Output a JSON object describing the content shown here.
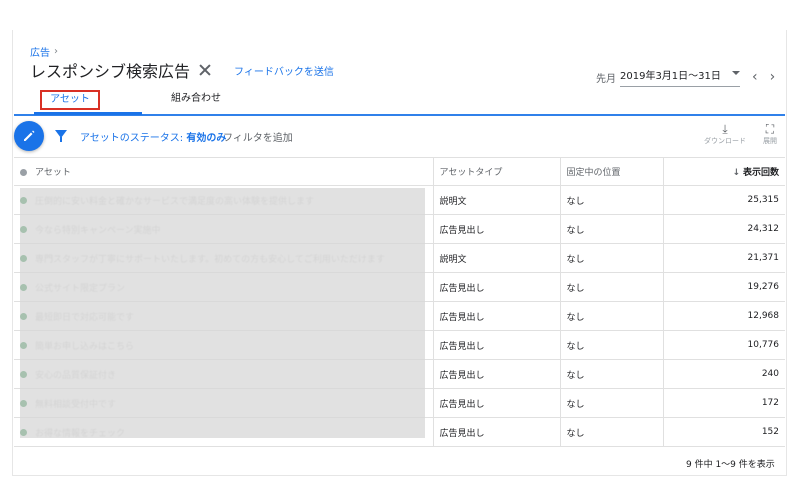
{
  "breadcrumb": {
    "parent": "広告"
  },
  "header": {
    "title": "レスポンシブ検索広告",
    "feedback": "フィードバックを送信"
  },
  "date_range": {
    "label": "先月",
    "value": "2019年3月1日～31日"
  },
  "tabs": [
    {
      "label": "アセット",
      "active": true
    },
    {
      "label": "組み合わせ",
      "active": false
    }
  ],
  "toolbar": {
    "filter_prefix": "アセットのステータス: ",
    "filter_value": "有効のみ",
    "add_filter": "フィルタを追加",
    "download_label": "ダウンロード",
    "expand_label": "展開"
  },
  "table": {
    "columns": [
      "アセット",
      "アセットタイプ",
      "固定中の位置",
      "表示回数"
    ],
    "rows": [
      {
        "asset": "圧倒的に安い料金と確かなサービスで満足度の高い体験を提供します",
        "type": "説明文",
        "position": "なし",
        "impressions": "25,315"
      },
      {
        "asset": "今なら特別キャンペーン実施中",
        "type": "広告見出し",
        "position": "なし",
        "impressions": "24,312"
      },
      {
        "asset": "専門スタッフが丁寧にサポートいたします。初めての方も安心してご利用いただけます",
        "type": "説明文",
        "position": "なし",
        "impressions": "21,371"
      },
      {
        "asset": "公式サイト限定プラン",
        "type": "広告見出し",
        "position": "なし",
        "impressions": "19,276"
      },
      {
        "asset": "最短即日で対応可能です",
        "type": "広告見出し",
        "position": "なし",
        "impressions": "12,968"
      },
      {
        "asset": "簡単お申し込みはこちら",
        "type": "広告見出し",
        "position": "なし",
        "impressions": "10,776"
      },
      {
        "asset": "安心の品質保証付き",
        "type": "広告見出し",
        "position": "なし",
        "impressions": "240"
      },
      {
        "asset": "無料相談受付中です",
        "type": "広告見出し",
        "position": "なし",
        "impressions": "172"
      },
      {
        "asset": "お得な情報をチェック",
        "type": "広告見出し",
        "position": "なし",
        "impressions": "152"
      }
    ]
  },
  "pagination": "9 件中 1～9 件を表示",
  "colors": {
    "accent": "#1a73e8",
    "status_green": "#188038",
    "highlight_red": "#d93025"
  }
}
